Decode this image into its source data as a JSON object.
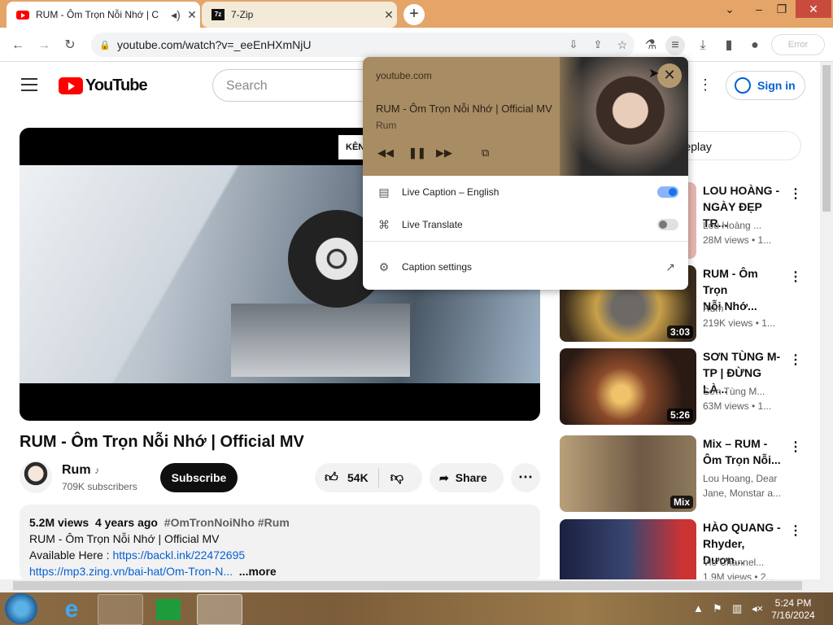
{
  "browser": {
    "tabs": [
      {
        "title": "RUM - Ôm Trọn Nỗi Nhớ | C",
        "audio_icon": "speaker-icon"
      },
      {
        "title": "7-Zip"
      }
    ],
    "new_tab": "+",
    "url": "youtube.com/watch?v=_eeEnHXmNjU",
    "profile_label": "Error"
  },
  "youtube": {
    "logo_text": "YouTube",
    "search_placeholder": "Search",
    "sign_in": "Sign in",
    "player_overlay_text": "KÊN",
    "video_title": "RUM - Ôm Trọn Nỗi Nhớ | Official MV",
    "channel": {
      "name": "Rum",
      "subscribers": "709K subscribers"
    },
    "subscribe": "Subscribe",
    "likes": "54K",
    "share": "Share",
    "description": {
      "views": "5.2M views",
      "age": "4 years ago",
      "tags": "#OmTronNoiNho #Rum",
      "line1": "RUM - Ôm Trọn Nỗi Nhớ |  Official MV",
      "line2_prefix": "Available Here : ",
      "line2_link": "https://backl.ink/22472695",
      "line3_link": "https://mp3.zing.vn/bai-hat/Om-Tron-N...",
      "more": "...more"
    },
    "live_replay": "t replay",
    "recommendations": [
      {
        "title1": "LOU HOÀNG -",
        "title2": "NGÀY ĐẸP TR...",
        "meta1": "Lou Hoàng ...",
        "meta2": "28M views  • 1...",
        "duration": ""
      },
      {
        "title1": "RUM - Ôm Trọn",
        "title2": "Nỗi Nhớ...",
        "meta1": "Rum",
        "meta2": "219K views  • 1...",
        "duration": "3:03"
      },
      {
        "title1": "SƠN TÙNG M-",
        "title2": "TP | ĐỪNG LÀ...",
        "meta1": "Sơn Tùng M...",
        "meta2": "63M views  • 1...",
        "duration": "5:26"
      },
      {
        "title1": "Mix – RUM -",
        "title2": "Ôm Trọn Nỗi...",
        "meta1": "Lou Hoang, Dear",
        "meta2": "Jane, Monstar a...",
        "duration": "Mix"
      },
      {
        "title1": "HÀO QUANG -",
        "title2": "Rhyder, Dươn...",
        "meta1": "Vie Channel...",
        "meta2": "1.9M views  • 2...",
        "duration": ""
      }
    ]
  },
  "media_popup": {
    "site": "youtube.com",
    "song": "RUM - Ôm Trọn Nỗi Nhớ |  Official MV",
    "artist": "Rum",
    "live_caption_label": "Live Caption – English",
    "live_caption_on": true,
    "live_translate_label": "Live Translate",
    "live_translate_on": false,
    "caption_settings": "Caption settings"
  },
  "taskbar": {
    "time": "5:24 PM",
    "date": "7/16/2024"
  },
  "colors": {
    "tabstrip": "#e5a468",
    "youtube_red": "#ff0000",
    "link_blue": "#065fd4",
    "toggle_on": "#1a73e8"
  }
}
